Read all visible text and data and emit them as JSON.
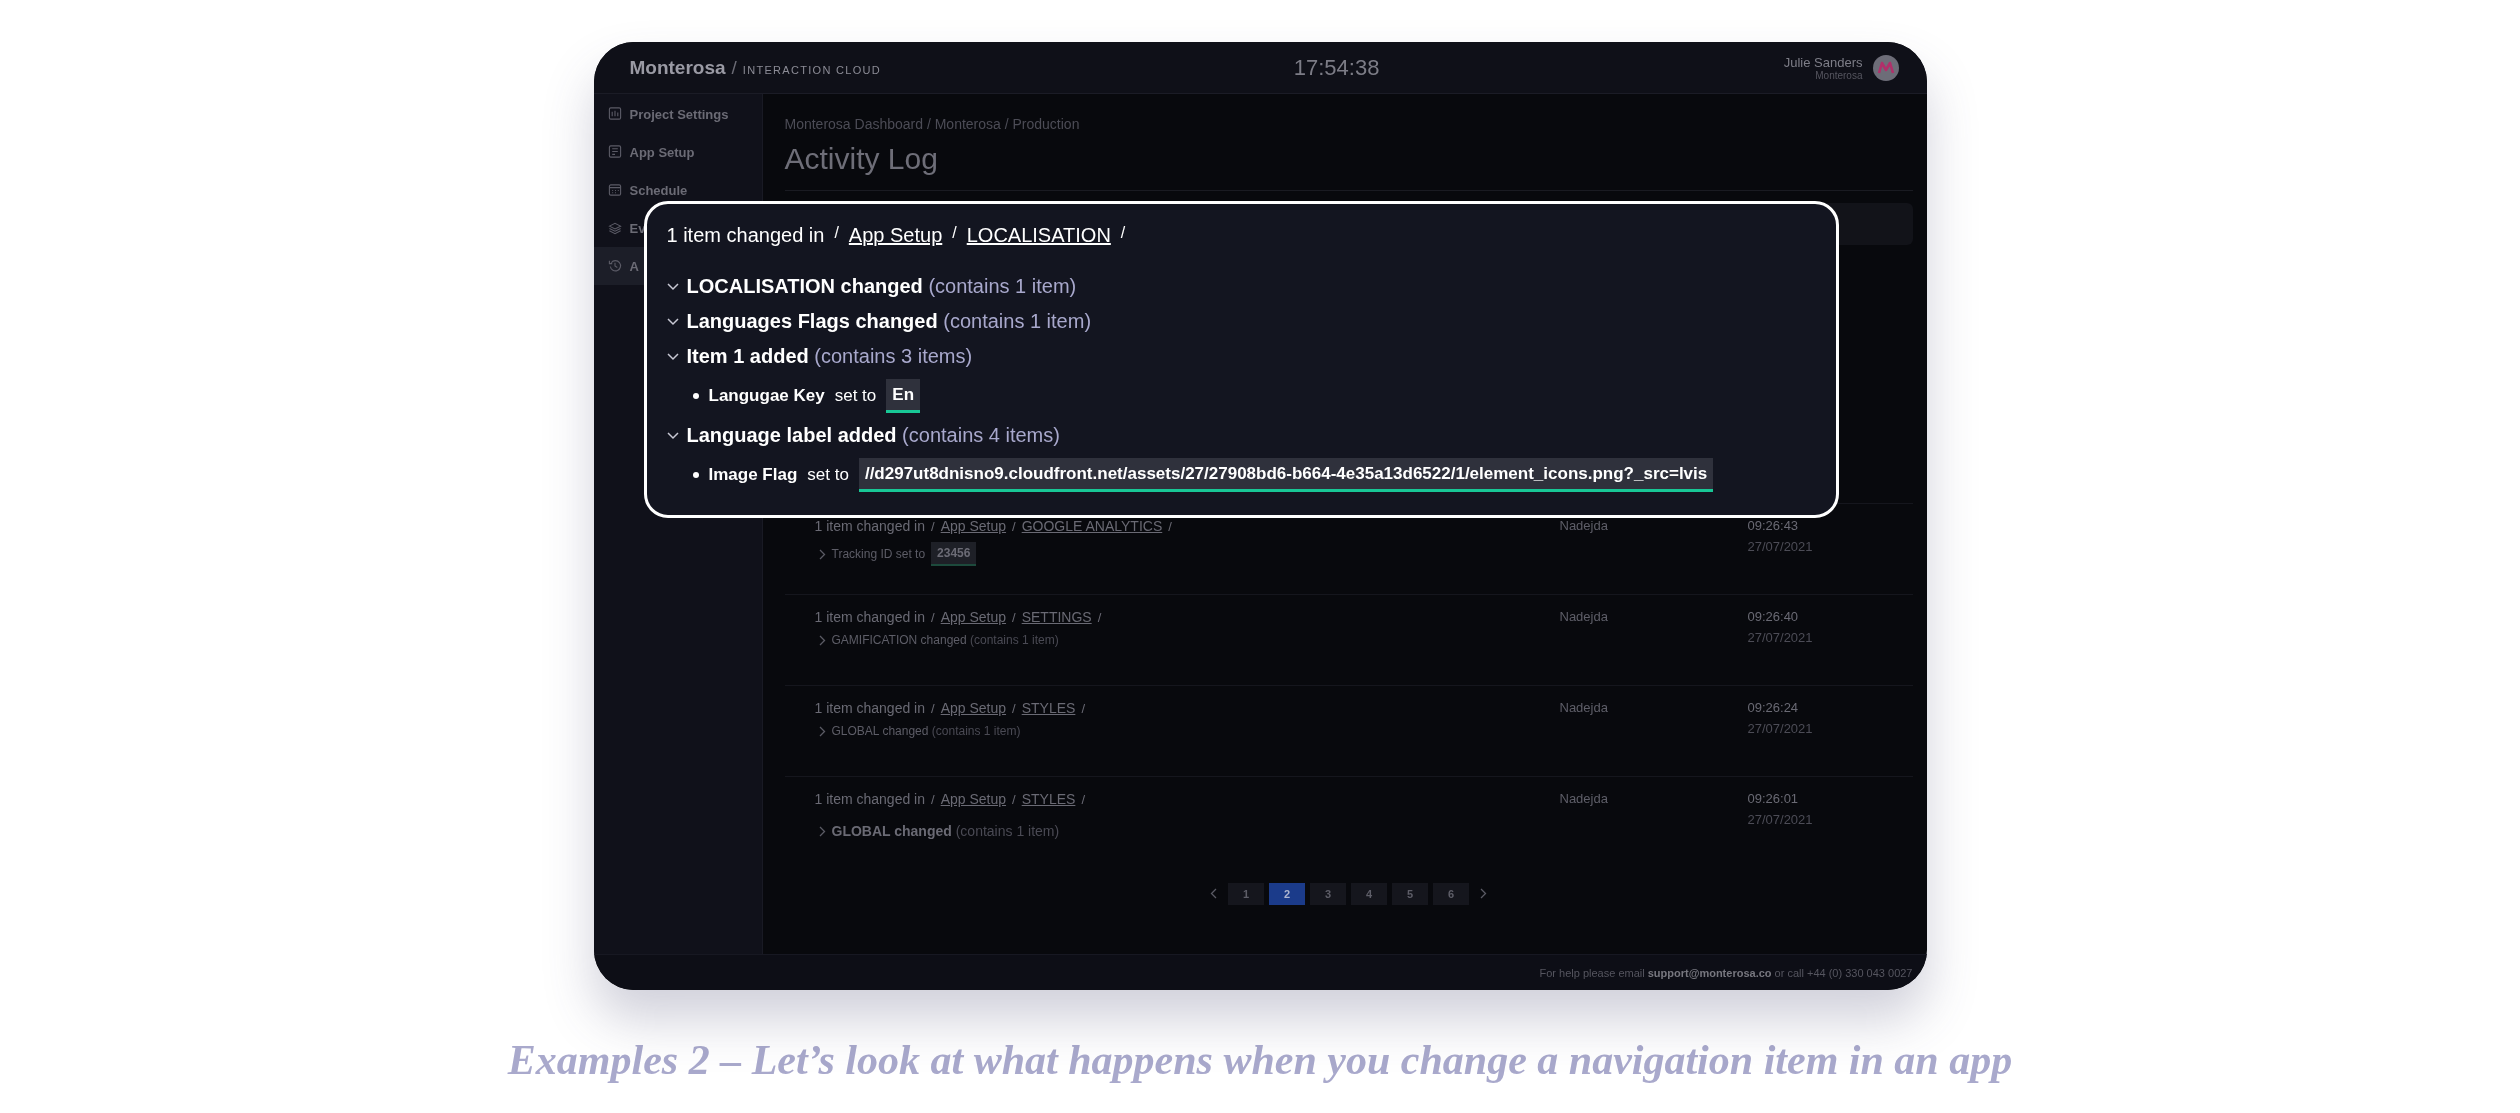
{
  "header": {
    "brand": "Monterosa",
    "separator": "/",
    "product": "INTERACTION CLOUD",
    "clock": "17:54:38",
    "user_name": "Julie Sanders",
    "user_org": "Monterosa"
  },
  "sidebar": {
    "items": [
      {
        "label": "Project Settings",
        "selected": false
      },
      {
        "label": "App Setup",
        "selected": false
      },
      {
        "label": "Schedule",
        "selected": false
      },
      {
        "label": "Ev",
        "selected": false
      },
      {
        "label": "A",
        "selected": true
      }
    ]
  },
  "breadcrumb": "Monterosa Dashboard / Monterosa / Production",
  "title": "Activity Log",
  "rows": [
    {
      "prefix": "1 item changed in",
      "path": [
        {
          "kind": "separator",
          "text": "/"
        },
        {
          "kind": "link",
          "text": "App Setup"
        },
        {
          "kind": "separator",
          "text": "/"
        },
        {
          "kind": "link",
          "text": "GOOGLE ANALYTICS"
        },
        {
          "kind": "separator",
          "text": "/"
        }
      ],
      "user": "Nadejda",
      "time": "09:26:43",
      "date": "27/07/2021",
      "detail": {
        "kind": "value",
        "label": "Tracking ID set to",
        "value": "23456"
      }
    },
    {
      "prefix": "1 item changed in",
      "path": [
        {
          "kind": "separator",
          "text": "/"
        },
        {
          "kind": "link",
          "text": "App Setup"
        },
        {
          "kind": "separator",
          "text": "/"
        },
        {
          "kind": "link",
          "text": "SETTINGS"
        },
        {
          "kind": "separator",
          "text": "/"
        }
      ],
      "user": "Nadejda",
      "time": "09:26:40",
      "date": "27/07/2021",
      "detail": {
        "kind": "changed",
        "label": "GAMIFICATION changed",
        "count": "(contains 1 item)",
        "emphasized": false
      }
    },
    {
      "prefix": "1 item changed in",
      "path": [
        {
          "kind": "separator",
          "text": "/"
        },
        {
          "kind": "link",
          "text": "App Setup"
        },
        {
          "kind": "separator",
          "text": "/"
        },
        {
          "kind": "link",
          "text": "STYLES"
        },
        {
          "kind": "separator",
          "text": "/"
        }
      ],
      "user": "Nadejda",
      "time": "09:26:24",
      "date": "27/07/2021",
      "detail": {
        "kind": "changed",
        "label": "GLOBAL changed",
        "count": "(contains 1 item)",
        "emphasized": false
      }
    },
    {
      "prefix": "1 item changed in",
      "path": [
        {
          "kind": "separator",
          "text": "/"
        },
        {
          "kind": "link",
          "text": "App Setup"
        },
        {
          "kind": "separator",
          "text": "/"
        },
        {
          "kind": "link",
          "text": "STYLES"
        },
        {
          "kind": "separator",
          "text": "/"
        }
      ],
      "user": "Nadejda",
      "time": "09:26:01",
      "date": "27/07/2021",
      "detail": {
        "kind": "changed",
        "label": "GLOBAL changed",
        "count": "(contains 1 item)",
        "emphasized": true
      }
    }
  ],
  "pagination": {
    "pages": [
      {
        "label": "1",
        "selected": false
      },
      {
        "label": "2",
        "selected": true
      },
      {
        "label": "3",
        "selected": false
      },
      {
        "label": "4",
        "selected": false
      },
      {
        "label": "5",
        "selected": false
      },
      {
        "label": "6",
        "selected": false
      }
    ]
  },
  "footer": "For help please email **support@monterosa.co** or call +44 (0) 330 043 0027",
  "popup": {
    "prefix": "1 item changed in",
    "path": [
      {
        "kind": "separator",
        "text": "/"
      },
      {
        "kind": "link",
        "text": "App Setup"
      },
      {
        "kind": "separator",
        "text": "/"
      },
      {
        "kind": "link",
        "text": "LOCALISATION"
      },
      {
        "kind": "separator",
        "text": "/"
      }
    ],
    "entries": [
      {
        "kind": "group",
        "title": "LOCALISATION changed",
        "count": "(contains 1 item)"
      },
      {
        "kind": "group",
        "title": "Languages Flags changed",
        "count": "(contains 1 item)"
      },
      {
        "kind": "group",
        "title": "Item 1 added",
        "count": "(contains 3 items)"
      },
      {
        "kind": "setting",
        "label": "Langugae Key",
        "connector": "set to",
        "value": "En"
      },
      {
        "kind": "group",
        "title": "Language label added",
        "count": "(contains 4 items)"
      },
      {
        "kind": "setting",
        "label": "Image Flag",
        "connector": "set to",
        "value": "//d297ut8dnisno9.cloudfront.net/assets/27/27908bd6-b664-4e35a13d6522/1/element_icons.png?_src=lvis"
      }
    ]
  },
  "caption": "Examples 2 – Let’s look at what happens when you change a navigation item in an app"
}
